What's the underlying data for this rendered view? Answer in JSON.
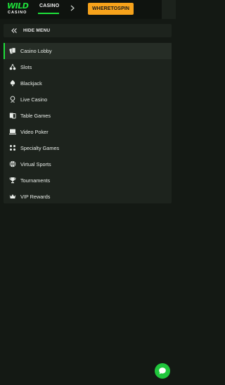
{
  "header": {
    "logo": {
      "line1": "WILD",
      "line2": "CASINO"
    },
    "nav_label": "CASINO",
    "cta_label": "WHERETOSPIN",
    "accent_color": "#1ee03a",
    "cta_color": "#f6a21b"
  },
  "menu_toggle": {
    "label": "HIDE MENU",
    "icon": "double-chevron-left-icon"
  },
  "menu": {
    "items": [
      {
        "label": "Casino Lobby",
        "icon": "cards-icon",
        "active": true
      },
      {
        "label": "Slots",
        "icon": "cherries-icon"
      },
      {
        "label": "Blackjack",
        "icon": "spade-icon"
      },
      {
        "label": "Live Casino",
        "icon": "dealer-icon"
      },
      {
        "label": "Table Games",
        "icon": "table-cards-icon"
      },
      {
        "label": "Video Poker",
        "icon": "monitor-icon"
      },
      {
        "label": "Specialty Games",
        "icon": "dice-icon"
      },
      {
        "label": "Virtual Sports",
        "icon": "basketball-icon"
      },
      {
        "label": "Tournaments",
        "icon": "trophy-icon"
      },
      {
        "label": "VIP Rewards",
        "icon": "crown-icon"
      }
    ]
  },
  "chat": {
    "icon": "chat-bubble-icon",
    "color": "#20c63c"
  }
}
